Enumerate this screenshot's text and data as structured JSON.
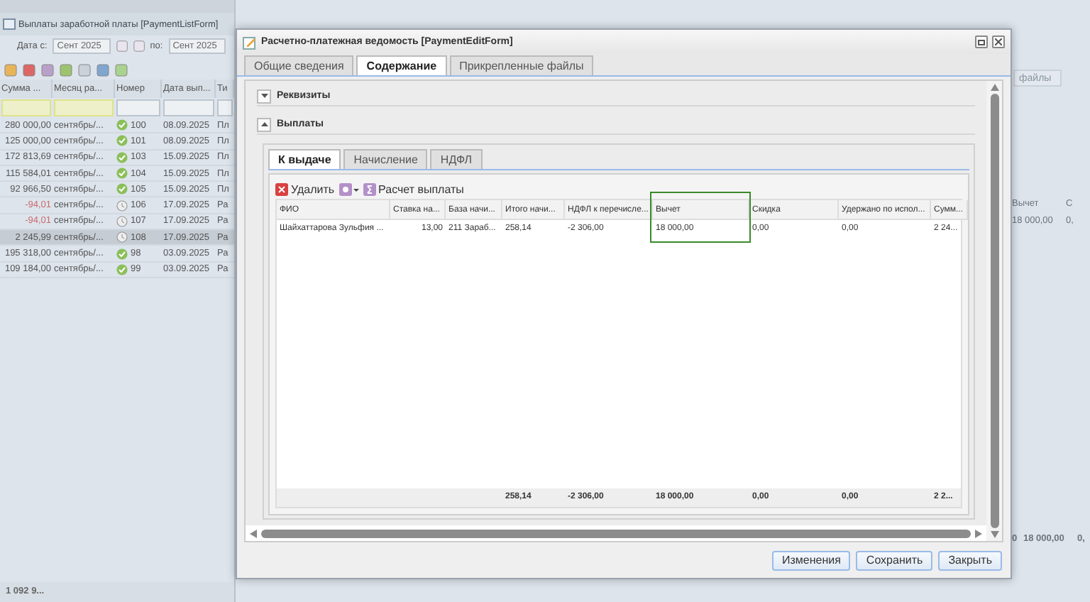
{
  "list_window": {
    "title": "Выплаты заработной платы [PaymentListForm]",
    "filter": {
      "from_label": "Дата с:",
      "from_value": "Сент 2025",
      "to_label": "по:",
      "to_value": "Сент 2025"
    },
    "columns": [
      "Сумма ...",
      "Месяц ра...",
      "Номер",
      "Дата вып...",
      "Ти"
    ],
    "rows": [
      {
        "amount": "280 000,00",
        "negative": false,
        "month": "сентябрь/...",
        "paid": true,
        "number": "100",
        "date": "08.09.2025",
        "type": "Пл",
        "selected": false
      },
      {
        "amount": "125 000,00",
        "negative": false,
        "month": "сентябрь/...",
        "paid": true,
        "number": "101",
        "date": "08.09.2025",
        "type": "Пл",
        "selected": false
      },
      {
        "amount": "172 813,69",
        "negative": false,
        "month": "сентябрь/...",
        "paid": true,
        "number": "103",
        "date": "15.09.2025",
        "type": "Пл",
        "selected": false
      },
      {
        "amount": "115 584,01",
        "negative": false,
        "month": "сентябрь/...",
        "paid": true,
        "number": "104",
        "date": "15.09.2025",
        "type": "Пл",
        "selected": false
      },
      {
        "amount": "92 966,50",
        "negative": false,
        "month": "сентябрь/...",
        "paid": true,
        "number": "105",
        "date": "15.09.2025",
        "type": "Пл",
        "selected": false
      },
      {
        "amount": "-94,01",
        "negative": true,
        "month": "сентябрь/...",
        "paid": false,
        "number": "106",
        "date": "17.09.2025",
        "type": "Ра",
        "selected": false
      },
      {
        "amount": "-94,01",
        "negative": true,
        "month": "сентябрь/...",
        "paid": false,
        "number": "107",
        "date": "17.09.2025",
        "type": "Ра",
        "selected": false
      },
      {
        "amount": "2 245,99",
        "negative": false,
        "month": "сентябрь/...",
        "paid": false,
        "number": "108",
        "date": "17.09.2025",
        "type": "Ра",
        "selected": true
      },
      {
        "amount": "195 318,00",
        "negative": false,
        "month": "сентябрь/...",
        "paid": true,
        "number": "98",
        "date": "03.09.2025",
        "type": "Ра",
        "selected": false
      },
      {
        "amount": "109 184,00",
        "negative": false,
        "month": "сентябрь/...",
        "paid": true,
        "number": "99",
        "date": "03.09.2025",
        "type": "Ра",
        "selected": false
      }
    ],
    "total": "1 092 9..."
  },
  "right_fragments": {
    "tab": "файлы",
    "columns": [
      "Вычет",
      "С"
    ],
    "row": [
      "18 000,00",
      "0,"
    ],
    "totals": [
      "0",
      "18 000,00",
      "0,"
    ]
  },
  "dialog": {
    "title": "Расчетно-платежная ведомость [PaymentEditForm]",
    "tabs": [
      {
        "label": "Общие сведения",
        "selected": false
      },
      {
        "label": "Содержание",
        "selected": true
      },
      {
        "label": "Прикрепленные файлы",
        "selected": false
      }
    ],
    "sections": [
      {
        "label": "Реквизиты",
        "expanded": false
      },
      {
        "label": "Выплаты",
        "expanded": true
      }
    ],
    "inner_tabs": [
      {
        "label": "К выдаче",
        "selected": true
      },
      {
        "label": "Начисление",
        "selected": false
      },
      {
        "label": "НДФЛ",
        "selected": false
      }
    ],
    "toolbar": {
      "delete": "Удалить",
      "calc": "Расчет выплаты"
    },
    "table": {
      "columns": [
        {
          "label": "ФИО",
          "highlighted": false
        },
        {
          "label": "Ставка на...",
          "highlighted": false
        },
        {
          "label": "База начи...",
          "highlighted": false
        },
        {
          "label": "Итого начи...",
          "highlighted": false
        },
        {
          "label": "НДФЛ к перечисле...",
          "highlighted": false
        },
        {
          "label": "Вычет",
          "highlighted": true
        },
        {
          "label": "Скидка",
          "highlighted": false
        },
        {
          "label": "Удержано по испол...",
          "highlighted": false
        },
        {
          "label": "Сумм...",
          "highlighted": false
        }
      ],
      "rows": [
        [
          "Шайхаттарова Зульфия ...",
          "13,00",
          "211 Зараб...",
          "258,14",
          "-2 306,00",
          "18 000,00",
          "0,00",
          "0,00",
          "2 24..."
        ]
      ],
      "totals": [
        "258,14",
        "-2 306,00",
        "18 000,00",
        "0,00",
        "0,00",
        "2 2..."
      ]
    },
    "buttons": [
      "Изменения",
      "Сохранить",
      "Закрыть"
    ]
  }
}
